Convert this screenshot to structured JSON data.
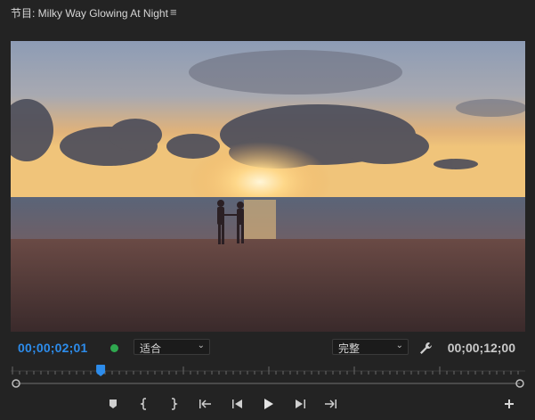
{
  "panel": {
    "title": "节目: Milky Way Glowing At Night",
    "menu_glyph": "≡"
  },
  "timecode": {
    "current": "00;00;02;01",
    "duration": "00;00;12;00"
  },
  "zoom": {
    "selected": "适合"
  },
  "resolution": {
    "selected": "完整"
  },
  "playhead": {
    "position_fraction": 0.168
  },
  "colors": {
    "accent_blue": "#2d8ceb",
    "status_green": "#2fa84f",
    "panel_bg": "#232323"
  },
  "icons": {
    "panel_menu": "hamburger-menu-icon",
    "wrench": "wrench-icon",
    "add_marker": "marker-icon",
    "mark_in": "mark-in-icon",
    "mark_out": "mark-out-icon",
    "go_to_in": "go-to-in-icon",
    "step_back": "step-back-icon",
    "play": "play-icon",
    "step_forward": "step-forward-icon",
    "go_to_out": "go-to-out-icon",
    "add_button": "plus-icon"
  }
}
